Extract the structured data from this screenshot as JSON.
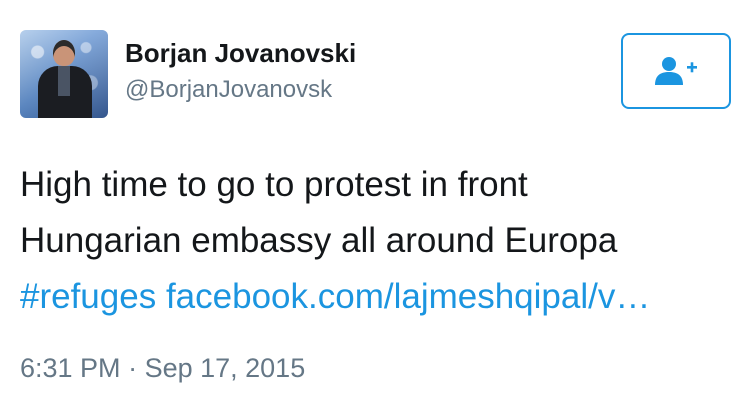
{
  "author": {
    "name": "Borjan Jovanovski",
    "handle": "@BorjanJovanovsk",
    "avatar_icon": "profile-photo"
  },
  "follow_button": {
    "icon": "follow-user-plus-icon",
    "color": "#1b95e0"
  },
  "tweet": {
    "line1": "High time to go to protest in front",
    "line2": "Hungarian embassy all around Europa",
    "hashtag": "#refuges",
    "url": "facebook.com/lajmeshqipal/v…"
  },
  "meta": {
    "time": "6:31 PM",
    "separator": " · ",
    "date": "Sep 17, 2015"
  }
}
